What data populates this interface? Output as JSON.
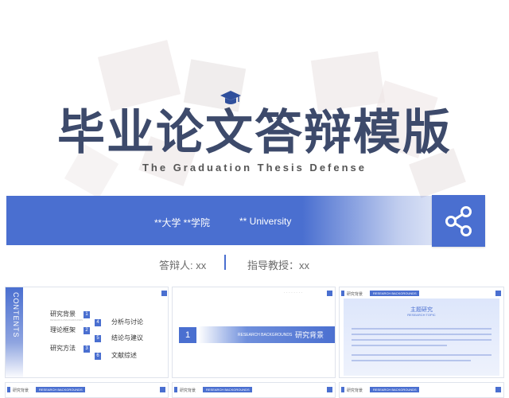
{
  "hero": {
    "title_cn": "毕业论文答辩模版",
    "title_en": "The Graduation Thesis Defense",
    "school_cn": "**大学 **学院",
    "school_en": "** University",
    "presenter": "答辩人: xx",
    "advisor": "指导教授：xx",
    "share_icon": "share-icon",
    "cap_icon": "graduation-cap-icon",
    "accent_color": "#4a6fd0"
  },
  "thumbnails": {
    "t1": {
      "contents_label": "CONTENTS",
      "items": [
        {
          "num": "1",
          "label": "研究背景"
        },
        {
          "num": "2",
          "label": "理论框架"
        },
        {
          "num": "3",
          "label": "研究方法"
        },
        {
          "num": "4",
          "label": "分析与讨论"
        },
        {
          "num": "5",
          "label": "结论与建议"
        },
        {
          "num": "6",
          "label": "文献综述"
        }
      ]
    },
    "t2": {
      "num": "1",
      "en": "RESEARCH BACKGROUNDS",
      "cn": "研究背景"
    },
    "t3": {
      "header_cn": "研究背景",
      "header_en": "RESEARCH BACKGROUNDS",
      "panel_title": "主题研究",
      "panel_sub": "RESEARCH TOPIC"
    },
    "t4": {
      "header_cn": "研究背景",
      "header_en": "RESEARCH BACKGROUNDS"
    },
    "t5": {
      "header_cn": "研究背景",
      "header_en": "RESEARCH BACKGROUNDS"
    },
    "t6": {
      "header_cn": "研究背景",
      "header_en": "RESEARCH BACKGROUNDS"
    }
  }
}
